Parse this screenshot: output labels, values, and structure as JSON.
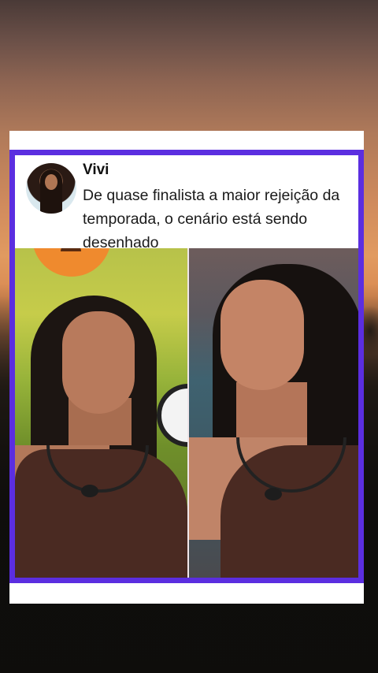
{
  "post": {
    "author": "Vivi",
    "text": "De quase finalista a maior rejeição da temporada, o cenário está sendo desenhado"
  },
  "colors": {
    "frame_accent": "#5b2ee0",
    "card_background": "#ffffff"
  },
  "images": {
    "avatar": "profile-photo",
    "left_photo": "woman-biting-lip-green-background",
    "right_photo": "woman-looking-sideways-blue-background"
  }
}
